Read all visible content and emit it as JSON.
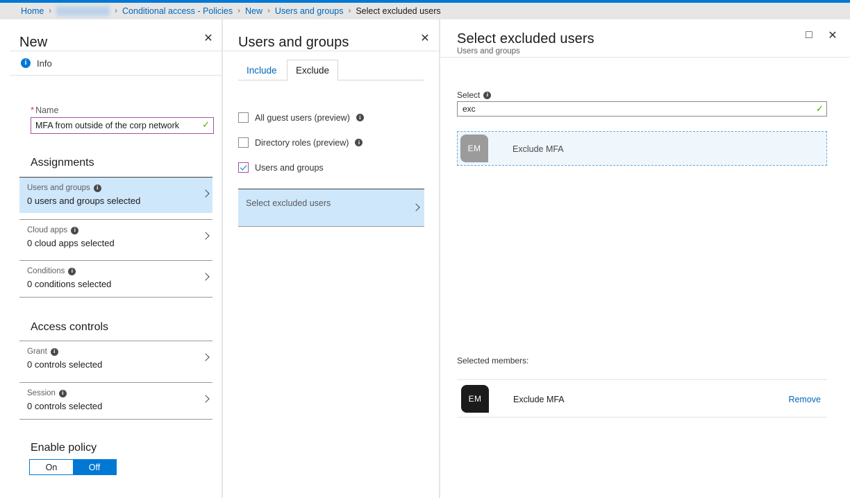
{
  "breadcrumb": {
    "items": [
      {
        "label": "Home",
        "state": "link"
      },
      {
        "label": "Inbrand Labs",
        "state": "redacted"
      },
      {
        "label": "Conditional access - Policies",
        "state": "link"
      },
      {
        "label": "New",
        "state": "link"
      },
      {
        "label": "Users and groups",
        "state": "link"
      },
      {
        "label": "Select excluded users",
        "state": "current"
      }
    ],
    "separator": "›"
  },
  "colors": {
    "accent": "#0078d4",
    "link": "#0066bb",
    "selected_row": "#cfe7fb",
    "validation_border": "#a0539c",
    "valid_check": "#5ca300",
    "required_star": "#d13438",
    "avatar_result": "#9b9b9b",
    "avatar_selected": "#1b1b1b"
  },
  "blade_new": {
    "title": "New",
    "close_glyph": "✕",
    "info_label": "Info",
    "info_glyph": "i",
    "name_field": {
      "label": "Name",
      "required_marker": "*",
      "value": "MFA from outside of the corp network",
      "placeholder": "",
      "valid_glyph": "✓"
    },
    "assignments": {
      "heading": "Assignments",
      "rows": [
        {
          "title": "Users and groups",
          "value": "0 users and groups selected",
          "selected": true
        },
        {
          "title": "Cloud apps",
          "value": "0 cloud apps selected",
          "selected": false
        },
        {
          "title": "Conditions",
          "value": "0 conditions selected",
          "selected": false
        }
      ]
    },
    "access_controls": {
      "heading": "Access controls",
      "rows": [
        {
          "title": "Grant",
          "value": "0 controls selected",
          "selected": false
        },
        {
          "title": "Session",
          "value": "0 controls selected",
          "selected": false
        }
      ]
    },
    "enable_policy": {
      "heading": "Enable policy",
      "on_label": "On",
      "off_label": "Off",
      "selected": "Off"
    }
  },
  "blade_users_groups": {
    "title": "Users and groups",
    "close_glyph": "✕",
    "tabs": [
      {
        "label": "Include",
        "active": false
      },
      {
        "label": "Exclude",
        "active": true
      }
    ],
    "checkboxes": [
      {
        "label": "All guest users (preview)",
        "checked": false,
        "has_info": true
      },
      {
        "label": "Directory roles (preview)",
        "checked": false,
        "has_info": true
      },
      {
        "label": "Users and groups",
        "checked": true,
        "has_info": false
      }
    ],
    "select_excluded_row": {
      "label": "Select excluded users",
      "selected": true
    }
  },
  "blade_select_excluded": {
    "title": "Select excluded users",
    "subtitle": "Users and groups",
    "maximize_glyph": "□",
    "close_glyph": "✕",
    "select_label": "Select",
    "search": {
      "value": "exc",
      "placeholder": "",
      "valid_glyph": "✓"
    },
    "results": [
      {
        "initials": "EM",
        "name": "Exclude MFA",
        "focused": true
      }
    ],
    "selected_members_label": "Selected members:",
    "selected_members": [
      {
        "initials": "EM",
        "name": "Exclude MFA",
        "action_label": "Remove"
      }
    ]
  }
}
